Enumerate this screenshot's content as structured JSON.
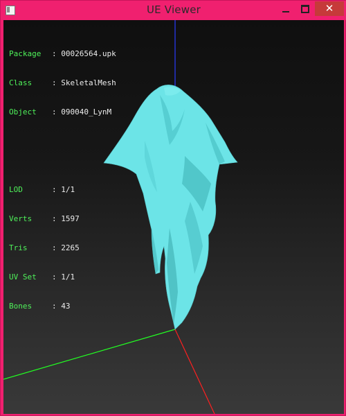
{
  "window": {
    "title": "UE Viewer"
  },
  "controls": {
    "close_glyph": "✕"
  },
  "info": {
    "group1": [
      {
        "key": "Package",
        "value": "00026564.upk"
      },
      {
        "key": "Class  ",
        "value": "SkeletalMesh"
      },
      {
        "key": "Object ",
        "value": "090040_LynM"
      }
    ],
    "group2": [
      {
        "key": "LOD    ",
        "value": "1/1"
      },
      {
        "key": "Verts  ",
        "value": "1597"
      },
      {
        "key": "Tris   ",
        "value": "2265"
      },
      {
        "key": "UV Set ",
        "value": "1/1"
      },
      {
        "key": "Bones  ",
        "value": "43"
      }
    ]
  },
  "colors": {
    "titlebar": "#f0206f",
    "close_button": "#c63a3a",
    "label": "#4ff25a",
    "value": "#ececec",
    "mesh": "#6fe7ea",
    "axis_x": "#ff2020",
    "axis_y": "#22ff22",
    "axis_z": "#2a3cff"
  }
}
